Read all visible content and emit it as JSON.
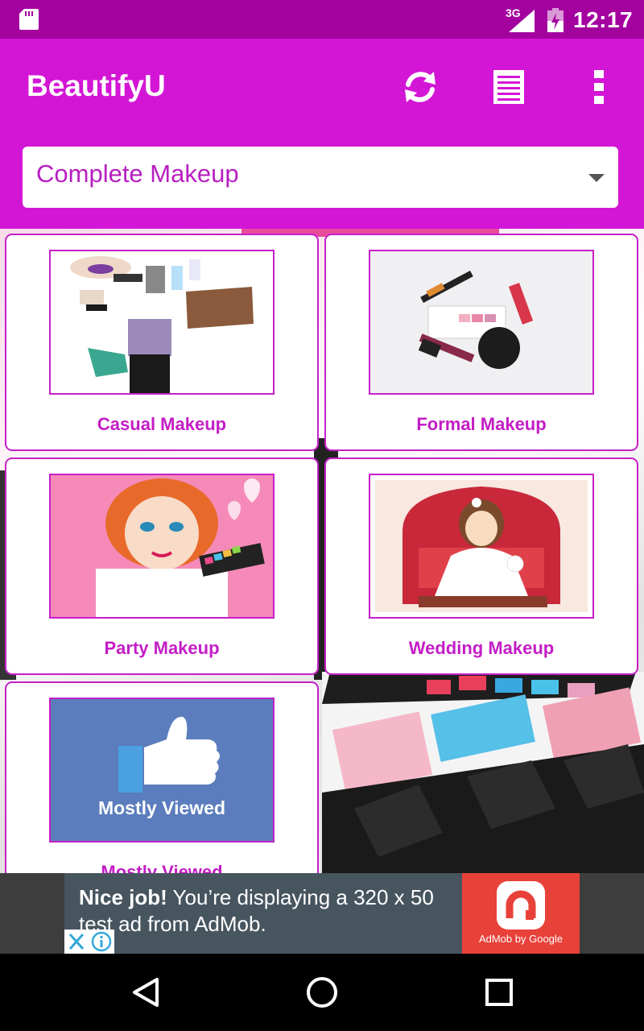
{
  "status_bar": {
    "network": "3G",
    "time": "12:17"
  },
  "app_bar": {
    "title": "BeautifyU",
    "actions": [
      {
        "icon": "refresh-icon"
      },
      {
        "icon": "list-icon"
      },
      {
        "icon": "more-vert-icon"
      }
    ]
  },
  "category_select": {
    "selected": "Complete Makeup"
  },
  "cards": [
    {
      "label": "Casual Makeup",
      "icon": "casual-makeup-image"
    },
    {
      "label": "Formal Makeup",
      "icon": "formal-makeup-image"
    },
    {
      "label": "Party Makeup",
      "icon": "party-makeup-image"
    },
    {
      "label": "Wedding Makeup",
      "icon": "wedding-makeup-image"
    },
    {
      "label": "Mostly Viewed",
      "icon": "mostly-viewed-image",
      "thumb_caption": "Mostly Viewed"
    }
  ],
  "ad": {
    "headline": "Nice job!",
    "body": " You’re displaying a 320 x 50 test ad from AdMob.",
    "brand": "AdMob by Google"
  },
  "colors": {
    "status_bar": "#a4029f",
    "app_bar": "#d316d6",
    "accent_text": "#c31dc6",
    "ad_brand": "#e8413a"
  }
}
